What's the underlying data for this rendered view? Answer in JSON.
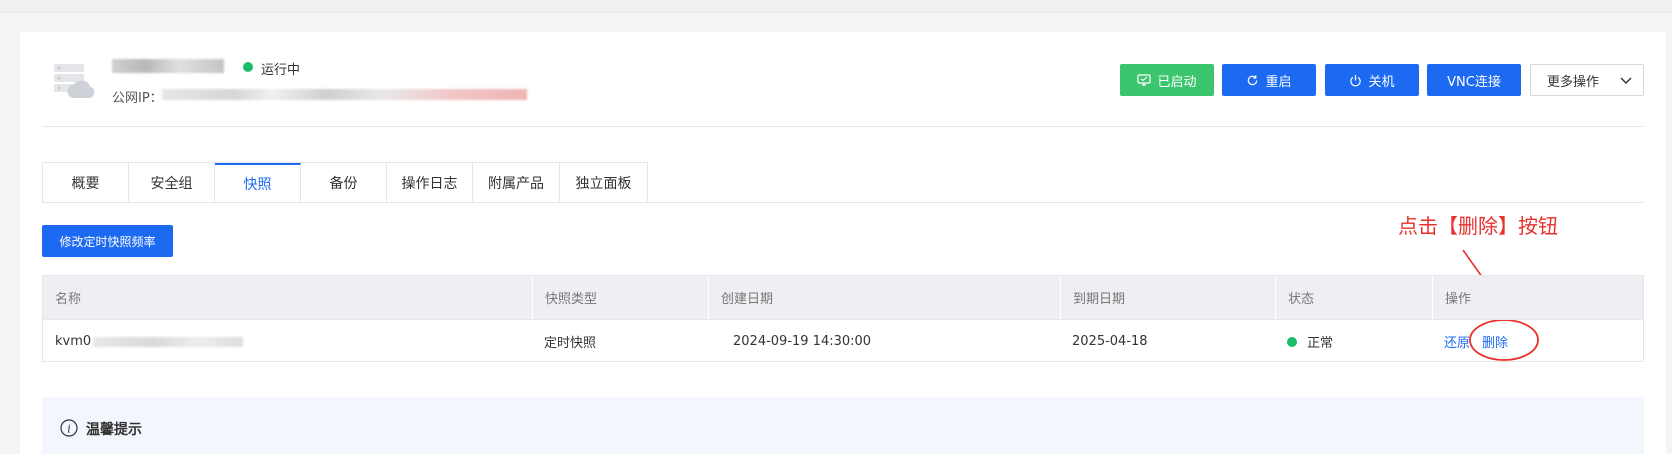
{
  "server": {
    "status_text": "运行中",
    "ip_label": "公网IP："
  },
  "toolbar": {
    "started_label": "已启动",
    "reboot_label": "重启",
    "shutdown_label": "关机",
    "vnc_label": "VNC连接",
    "more_label": "更多操作"
  },
  "tabs": [
    {
      "label": "概要"
    },
    {
      "label": "安全组"
    },
    {
      "label": "快照",
      "active": true
    },
    {
      "label": "备份"
    },
    {
      "label": "操作日志"
    },
    {
      "label": "附属产品"
    },
    {
      "label": "独立面板"
    }
  ],
  "snapshot": {
    "modify_label": "修改定时快照频率",
    "columns": [
      "名称",
      "快照类型",
      "创建日期",
      "到期日期",
      "状态",
      "操作"
    ],
    "rows": [
      {
        "name_prefix": "kvm0",
        "type": "定时快照",
        "created": "2024-09-19 14:30:00",
        "expires": "2025-04-18",
        "status": "正常",
        "restore_label": "还原",
        "delete_label": "删除"
      }
    ]
  },
  "annotation": {
    "text": "点击【删除】按钮"
  },
  "tips": {
    "title": "温馨提示"
  },
  "colors": {
    "primary": "#1d6af2",
    "success": "#3cc56f",
    "annotation": "#e8312c"
  }
}
